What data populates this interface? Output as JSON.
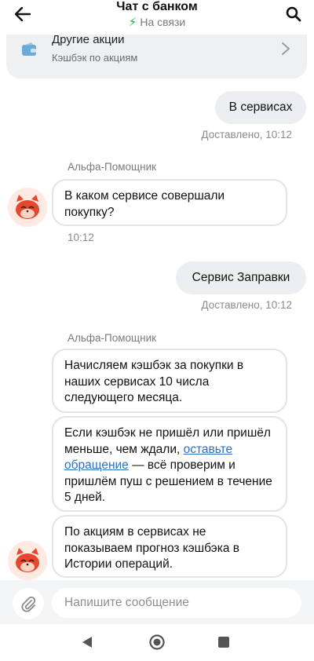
{
  "header": {
    "title": "Чат с банком",
    "status": "На связи",
    "back_icon": "arrow-left-icon",
    "search_icon": "search-icon"
  },
  "promo_card": {
    "title": "Другие акции",
    "subtitle": "Кэшбэк по акциям",
    "icon": "wallet-icon"
  },
  "messages": [
    {
      "type": "outgoing",
      "text": "В сервисах",
      "status": "Доставлено, 10:12"
    },
    {
      "type": "incoming",
      "sender": "Альфа-Помощник",
      "text": "В каком сервисе совершали покупку?",
      "time": "10:12"
    },
    {
      "type": "outgoing",
      "text": "Сервис Заправки",
      "status": "Доставлено, 10:12"
    },
    {
      "type": "incoming_group",
      "sender": "Альфа-Помощник",
      "bubble1": "Начисляем кэшбэк за покупки в наших сервисах 10 числа следующего месяца.",
      "bubble2_before": "Если кэшбэк не пришёл или пришёл меньше, чем ждали, ",
      "bubble2_link": "оставьте обращение",
      "bubble2_after": " — всё проверим и пришлём пуш с решением в течение 5 дней.",
      "bubble3": "По акциям в сервисах не показываем прогноз кэшбэка в Истории операций."
    }
  ],
  "composer": {
    "placeholder": "Напишите сообщение",
    "attach_icon": "paperclip-icon"
  },
  "nav": {
    "back_icon": "triangle-back-icon",
    "home_icon": "circle-home-icon",
    "recents_icon": "square-recents-icon"
  },
  "colors": {
    "status_green": "#22b14c",
    "link_blue": "#2e6fbd",
    "outgoing_bubble": "#eceef1",
    "avatar_red": "#e5482c"
  }
}
